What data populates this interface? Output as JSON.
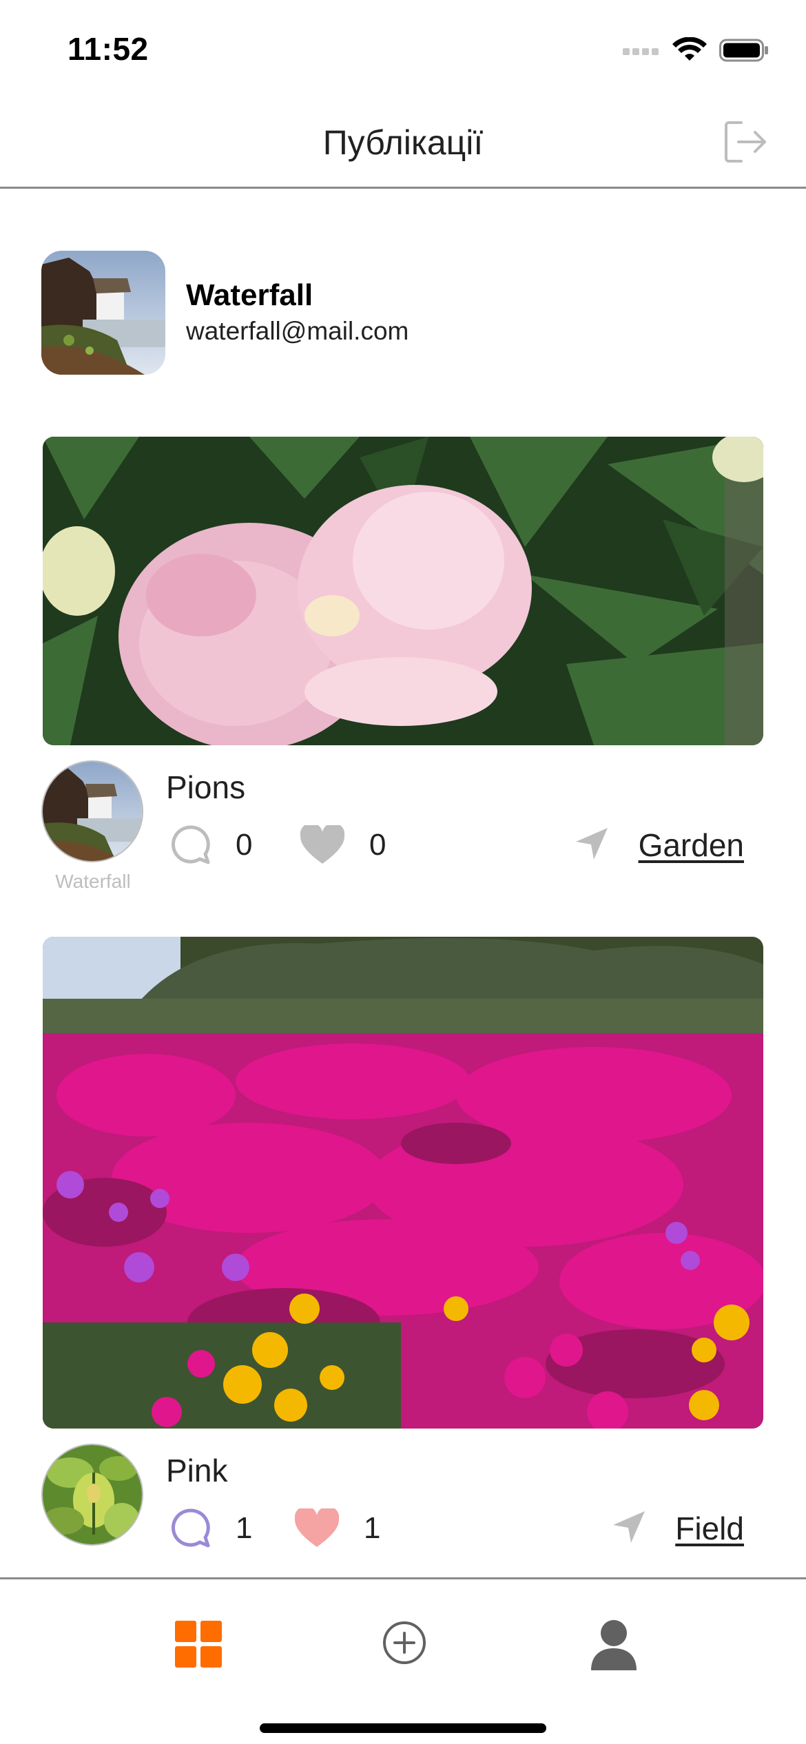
{
  "status_bar": {
    "time": "11:52"
  },
  "header": {
    "title": "Публікації",
    "logout_icon": "logout-icon"
  },
  "profile": {
    "name": "Waterfall",
    "email": "waterfall@mail.com"
  },
  "posts": [
    {
      "title": "Pions",
      "author": "Waterfall",
      "comments": "0",
      "likes": "0",
      "location": "Garden",
      "comment_icon_color": "#bdbdbd",
      "like_icon_color": "#bdbdbd"
    },
    {
      "title": "Pink",
      "author": "",
      "comments": "1",
      "likes": "1",
      "location": "Field",
      "comment_icon_color": "#9b8ad6",
      "like_icon_color": "#f5a3a3"
    }
  ],
  "tab_bar": {
    "tabs": [
      {
        "icon": "grid-icon",
        "active": true
      },
      {
        "icon": "add-circle-icon",
        "active": false
      },
      {
        "icon": "user-icon",
        "active": false
      }
    ],
    "accent_color": "#ff6c00"
  }
}
